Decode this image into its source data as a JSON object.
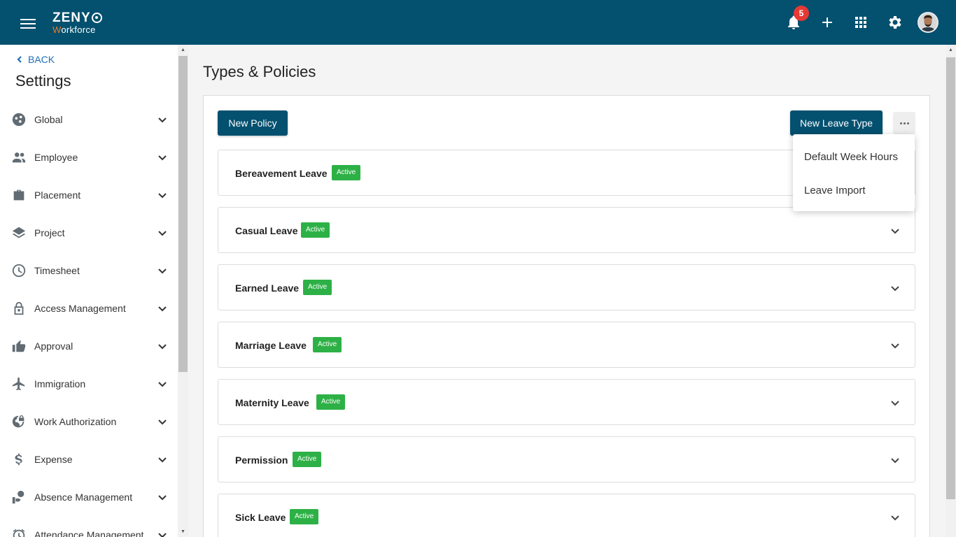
{
  "app": {
    "brand_top": "ZENY",
    "brand_bottom_first": "W",
    "brand_bottom_rest": "orkforce",
    "notification_count": "5"
  },
  "sidebar": {
    "back_label": "BACK",
    "title": "Settings",
    "items": [
      {
        "label": "Global",
        "icon": "global-icon"
      },
      {
        "label": "Employee",
        "icon": "people-icon"
      },
      {
        "label": "Placement",
        "icon": "briefcase-icon"
      },
      {
        "label": "Project",
        "icon": "layers-icon"
      },
      {
        "label": "Timesheet",
        "icon": "clock-icon"
      },
      {
        "label": "Access Management",
        "icon": "lock-icon"
      },
      {
        "label": "Approval",
        "icon": "thumbs-up-icon"
      },
      {
        "label": "Immigration",
        "icon": "airplane-icon"
      },
      {
        "label": "Work Authorization",
        "icon": "globe-lock-icon"
      },
      {
        "label": "Expense",
        "icon": "dollar-icon"
      },
      {
        "label": "Absence Management",
        "icon": "person-desk-icon"
      },
      {
        "label": "Attendance Management",
        "icon": "alarm-icon"
      }
    ]
  },
  "main": {
    "title": "Types & Policies",
    "new_policy_label": "New Policy",
    "new_leave_type_label": "New Leave Type",
    "menu": {
      "items": [
        "Default Week Hours",
        "Leave Import"
      ]
    },
    "leave_types": [
      {
        "name": "Bereavement Leave",
        "status": "Active"
      },
      {
        "name": "Casual Leave",
        "status": "Active"
      },
      {
        "name": "Earned Leave",
        "status": "Active"
      },
      {
        "name": "Marriage Leave",
        "status": "Active"
      },
      {
        "name": "Maternity Leave",
        "status": "Active"
      },
      {
        "name": "Permission",
        "status": "Active"
      },
      {
        "name": "Sick Leave",
        "status": "Active"
      }
    ]
  },
  "colors": {
    "header": "#03506f",
    "accent": "#f47a20",
    "active_badge": "#2db146",
    "link": "#1f6fb5",
    "notification": "#e53935"
  }
}
